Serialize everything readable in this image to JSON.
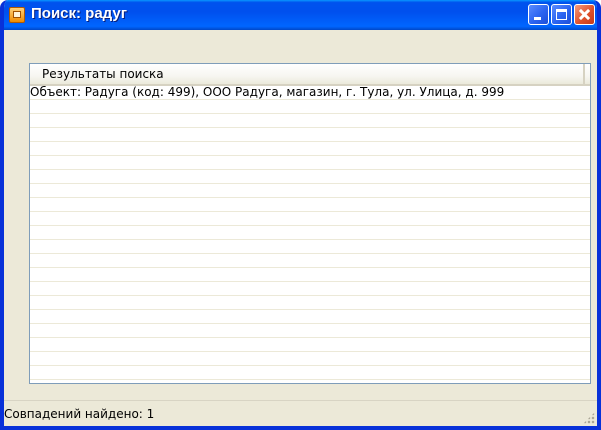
{
  "window": {
    "title": "Поиск: радуг",
    "icon": "app-lock-icon"
  },
  "title_buttons": {
    "minimize_icon": "minimize-icon",
    "maximize_icon": "maximize-icon",
    "close_icon": "close-icon"
  },
  "results": {
    "column_header": "Результаты поиска",
    "rows": [
      "Объект: Радуга (код: 499), ООО Радуга, магазин, г. Тула, ул. Улица, д. 999"
    ]
  },
  "status": {
    "text": "Совпадений найдено: 1"
  },
  "colors": {
    "titlebar": "#0053ee",
    "frame": "#0831d9",
    "window_bg": "#ece9d8",
    "close_button": "#e0522c"
  }
}
